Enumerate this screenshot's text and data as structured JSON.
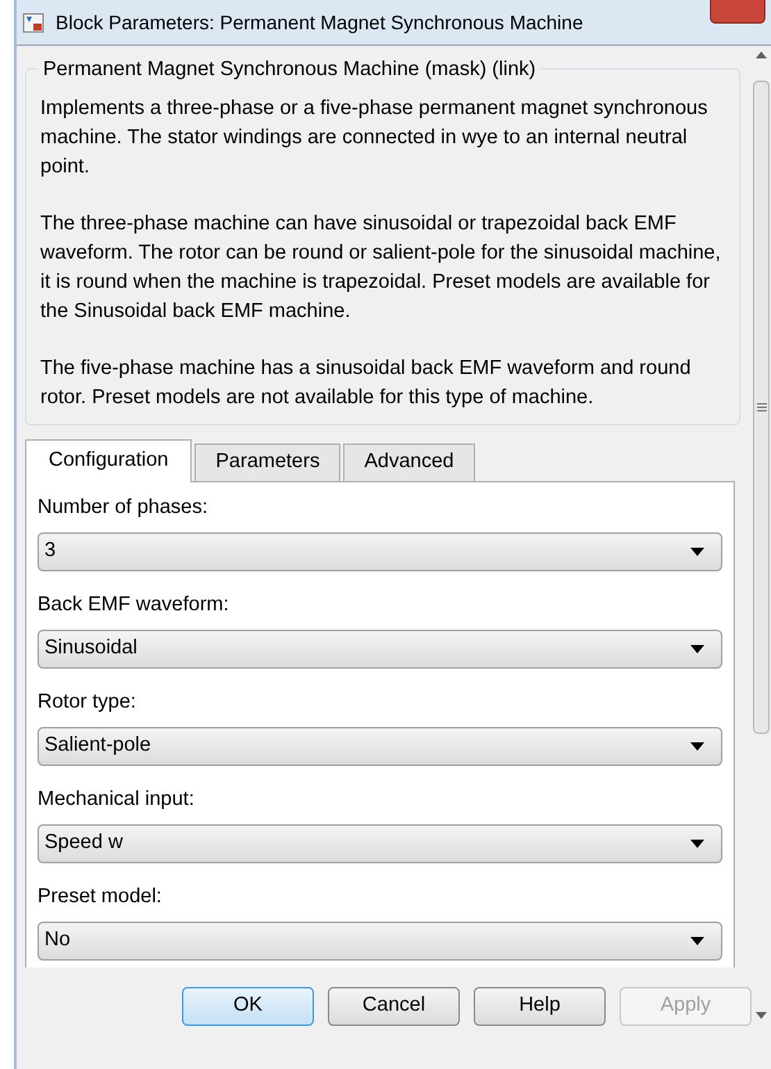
{
  "window": {
    "title": "Block Parameters: Permanent Magnet Synchronous Machine"
  },
  "group": {
    "title": "Permanent Magnet Synchronous Machine (mask) (link)",
    "paragraphs": [
      "Implements a three-phase or a five-phase permanent magnet synchronous machine. The stator windings are connected in wye to an internal neutral point.",
      "The three-phase machine can have sinusoidal or trapezoidal back EMF waveform. The rotor can be round or salient-pole for the sinusoidal machine, it is round when the machine is trapezoidal. Preset models are available for the Sinusoidal back EMF machine.",
      "The five-phase machine has a sinusoidal back EMF waveform and round rotor. Preset models are not available for this type of machine."
    ]
  },
  "tabs": [
    {
      "label": "Configuration",
      "selected": true
    },
    {
      "label": "Parameters",
      "selected": false
    },
    {
      "label": "Advanced",
      "selected": false
    }
  ],
  "fields": [
    {
      "label": "Number of phases:",
      "value": "3"
    },
    {
      "label": "Back EMF waveform:",
      "value": "Sinusoidal"
    },
    {
      "label": "Rotor type:",
      "value": "Salient-pole"
    },
    {
      "label": "Mechanical input:",
      "value": "Speed w"
    },
    {
      "label": "Preset model:",
      "value": "No"
    }
  ],
  "buttons": [
    {
      "label": "OK",
      "default": true,
      "disabled": false
    },
    {
      "label": "Cancel",
      "default": false,
      "disabled": false
    },
    {
      "label": "Help",
      "default": false,
      "disabled": false
    },
    {
      "label": "Apply",
      "default": false,
      "disabled": true
    }
  ]
}
